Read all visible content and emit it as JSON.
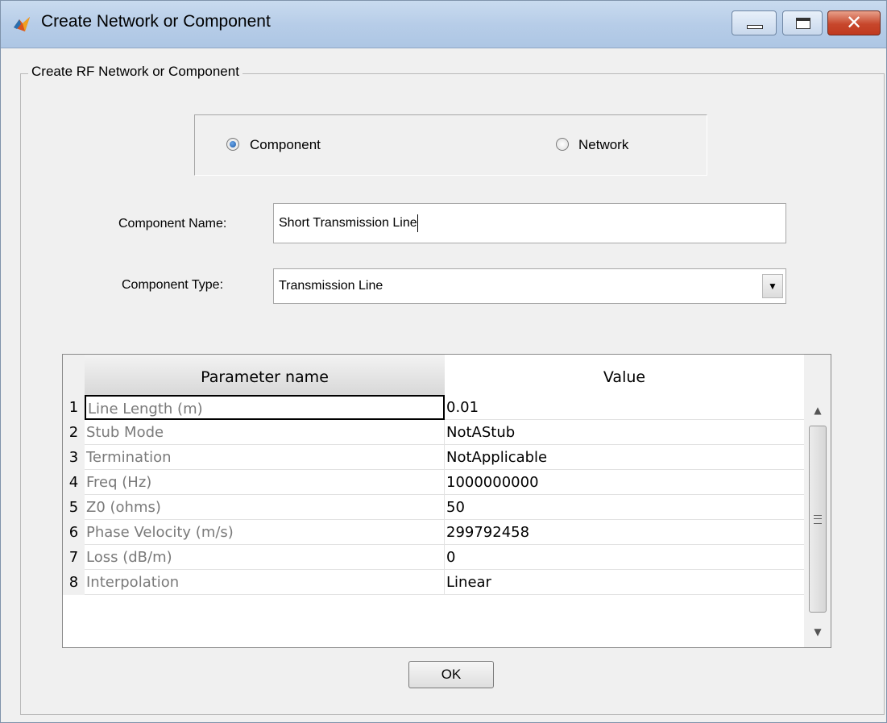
{
  "window": {
    "title": "Create Network or Component"
  },
  "group": {
    "label": "Create RF Network or Component"
  },
  "radio": {
    "component_label": "Component",
    "network_label": "Network",
    "selected": "Component"
  },
  "form": {
    "name_label": "Component Name:",
    "name_value": "Short Transmission Line",
    "type_label": "Component Type:",
    "type_value": "Transmission Line"
  },
  "table": {
    "headers": {
      "parameter": "Parameter name",
      "value": "Value"
    },
    "rows": [
      {
        "num": "1",
        "name": "Line Length (m)",
        "value": "0.01"
      },
      {
        "num": "2",
        "name": "Stub Mode",
        "value": "NotAStub"
      },
      {
        "num": "3",
        "name": "Termination",
        "value": "NotApplicable"
      },
      {
        "num": "4",
        "name": "Freq (Hz)",
        "value": "1000000000"
      },
      {
        "num": "5",
        "name": "Z0 (ohms)",
        "value": "50"
      },
      {
        "num": "6",
        "name": "Phase Velocity (m/s)",
        "value": "299792458"
      },
      {
        "num": "7",
        "name": "Loss (dB/m)",
        "value": "0"
      },
      {
        "num": "8",
        "name": "Interpolation",
        "value": "Linear"
      }
    ]
  },
  "buttons": {
    "ok": "OK"
  },
  "icons": {
    "app": "matlab-logo-icon",
    "minimize": "minimize-icon",
    "maximize": "maximize-icon",
    "close": "close-icon",
    "dropdown": "dropdown-arrow-icon"
  },
  "colors": {
    "close_button": "#c7472c",
    "titlebar": "#b7cde8",
    "radio_dot": "#1c5aa8"
  }
}
